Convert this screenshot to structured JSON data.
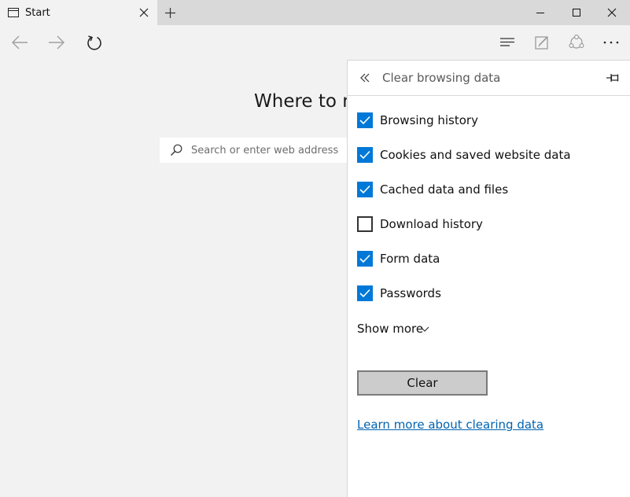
{
  "titlebar": {
    "tab_title": "Start",
    "icons": {
      "tab": "tab-page-icon",
      "close_tab": "close-icon",
      "new_tab": "plus-icon",
      "minimize": "minimize-icon",
      "maximize": "maximize-icon",
      "close_window": "close-icon"
    }
  },
  "navbar": {
    "icons": [
      "back-arrow-icon",
      "forward-arrow-icon",
      "refresh-icon",
      "hub-icon",
      "web-note-icon",
      "share-icon",
      "more-icon"
    ]
  },
  "start_page": {
    "heading": "Where to n",
    "search": {
      "placeholder": "Search or enter web address",
      "value": ""
    }
  },
  "panel": {
    "title": "Clear browsing data",
    "options": [
      {
        "label": "Browsing history",
        "checked": true
      },
      {
        "label": "Cookies and saved website data",
        "checked": true
      },
      {
        "label": "Cached data and files",
        "checked": true
      },
      {
        "label": "Download history",
        "checked": false
      },
      {
        "label": "Form data",
        "checked": true
      },
      {
        "label": "Passwords",
        "checked": true
      }
    ],
    "show_more_label": "Show more",
    "clear_label": "Clear",
    "learn_more_label": "Learn more about clearing data"
  },
  "colors": {
    "accent": "#0078d7",
    "link": "#0063b1",
    "titlebar": "#d9d9d9",
    "page_background": "#f2f2f2",
    "panel_background": "#ffffff"
  }
}
